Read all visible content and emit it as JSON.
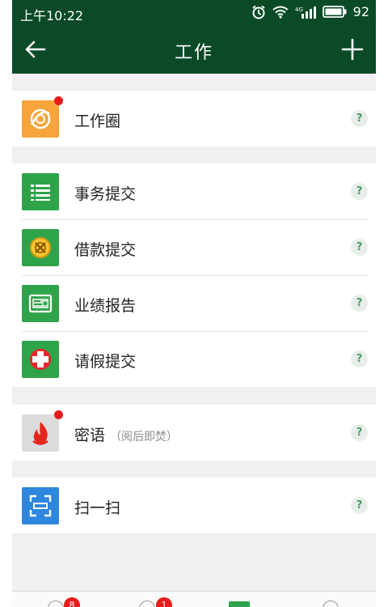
{
  "status": {
    "time": "上午10:22",
    "battery": "92",
    "network": "4G"
  },
  "nav": {
    "title": "工作"
  },
  "colors": {
    "header": "#0a4a27",
    "green": "#2fa34a",
    "orange": "#f5a53a",
    "blue": "#2e86de",
    "red_dot": "#e81b1b"
  },
  "groups": [
    {
      "items": [
        {
          "label": "工作圈",
          "icon": "work-circle-icon",
          "dot": true
        }
      ]
    },
    {
      "items": [
        {
          "label": "事务提交",
          "icon": "list-icon"
        },
        {
          "label": "借款提交",
          "icon": "money-icon"
        },
        {
          "label": "业绩报告",
          "icon": "report-icon"
        },
        {
          "label": "请假提交",
          "icon": "cross-icon"
        }
      ]
    },
    {
      "items": [
        {
          "label": "密语",
          "sub": "（阅后即焚）",
          "icon": "fire-icon",
          "dot": true
        }
      ]
    },
    {
      "items": [
        {
          "label": "扫一扫",
          "icon": "scan-icon"
        }
      ]
    }
  ],
  "help_symbol": "?",
  "tabbar": {
    "badges": [
      "8",
      "1"
    ]
  }
}
